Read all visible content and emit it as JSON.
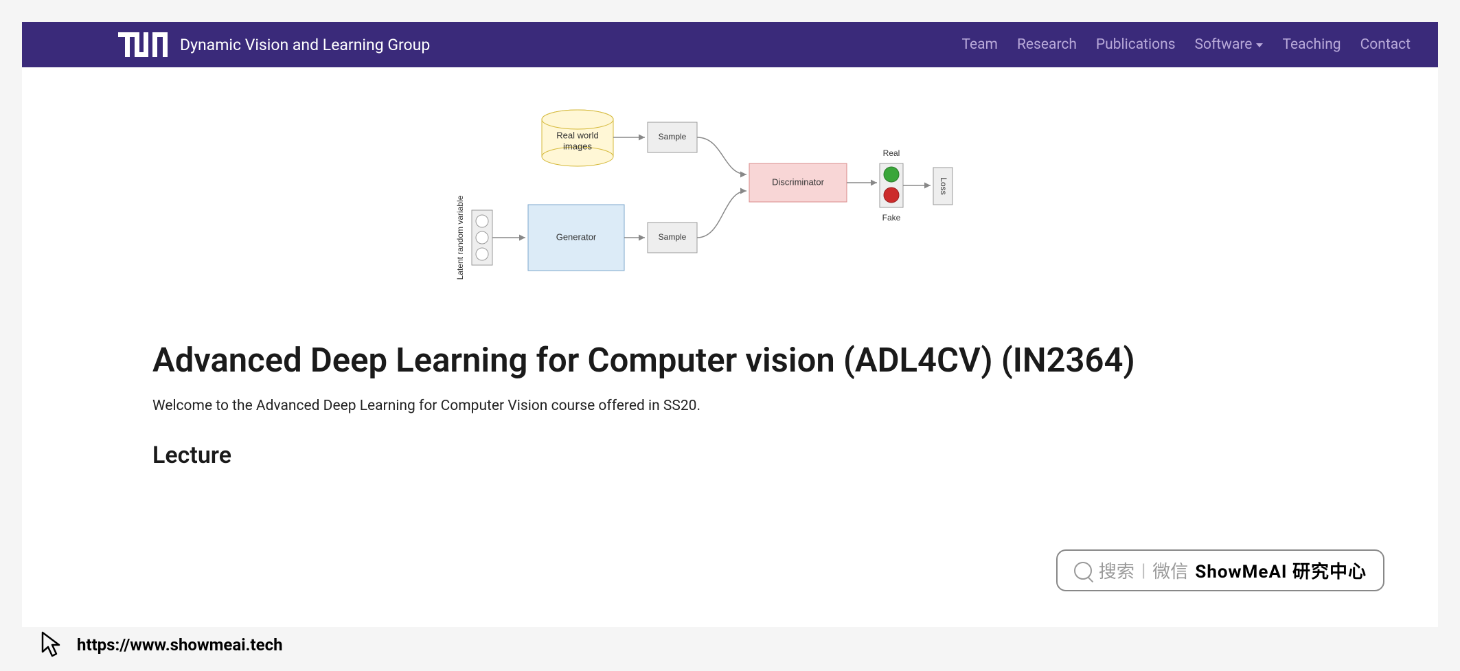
{
  "nav": {
    "group_name": "Dynamic Vision and Learning Group",
    "items": [
      "Team",
      "Research",
      "Publications",
      "Software",
      "Teaching",
      "Contact"
    ],
    "dropdown_index": 3
  },
  "page": {
    "title": "Advanced Deep Learning for Computer vision (ADL4CV) (IN2364)",
    "subtitle": "Welcome to the Advanced Deep Learning for Computer Vision course offered in SS20.",
    "section_heading": "Lecture"
  },
  "diagram": {
    "latent_label": "Latent random variable",
    "real_world": "Real world\nimages",
    "generator": "Generator",
    "sample1": "Sample",
    "sample2": "Sample",
    "discriminator": "Discriminator",
    "real": "Real",
    "fake": "Fake",
    "loss": "Loss"
  },
  "watermark": {
    "search_label": "搜索",
    "wechat_label": "微信",
    "brand": "ShowMeAI 研究中心"
  },
  "overlay": {
    "url": "https://www.showmeai.tech"
  }
}
